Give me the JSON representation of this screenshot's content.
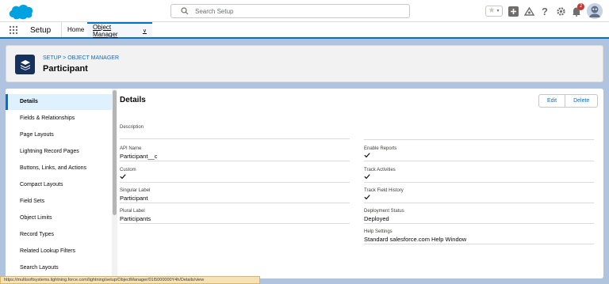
{
  "header": {
    "search_placeholder": "Search Setup",
    "notification_count": "2"
  },
  "context": {
    "app_name": "Setup",
    "tabs": [
      {
        "label": "Home"
      },
      {
        "label": "Object Manager"
      }
    ]
  },
  "page_header": {
    "breadcrumb": "SETUP > OBJECT MANAGER",
    "title": "Participant"
  },
  "sidebar": {
    "items": [
      {
        "label": "Details",
        "active": true
      },
      {
        "label": "Fields & Relationships"
      },
      {
        "label": "Page Layouts"
      },
      {
        "label": "Lightning Record Pages"
      },
      {
        "label": "Buttons, Links, and Actions"
      },
      {
        "label": "Compact Layouts"
      },
      {
        "label": "Field Sets"
      },
      {
        "label": "Object Limits"
      },
      {
        "label": "Record Types"
      },
      {
        "label": "Related Lookup Filters"
      },
      {
        "label": "Search Layouts"
      }
    ]
  },
  "details": {
    "title": "Details",
    "edit_label": "Edit",
    "delete_label": "Delete",
    "left_fields": [
      {
        "label": "Description",
        "value": ""
      },
      {
        "label": "API Name",
        "value": "Participant__c"
      },
      {
        "label": "Custom",
        "value": "",
        "checked": true
      },
      {
        "label": "Singular Label",
        "value": "Participant"
      },
      {
        "label": "Plural Label",
        "value": "Participants"
      }
    ],
    "right_fields": [
      {
        "label": "Enable Reports",
        "value": "",
        "checked": true
      },
      {
        "label": "Track Activities",
        "value": "",
        "checked": true
      },
      {
        "label": "Track Field History",
        "value": "",
        "checked": true
      },
      {
        "label": "Deployment Status",
        "value": "Deployed"
      },
      {
        "label": "Help Settings",
        "value": "Standard salesforce.com Help Window"
      }
    ]
  },
  "status_url": "https://multisoftsystems.lightning.force.com/lightning/setup/ObjectManager/01I5000000Y4h/Details/view",
  "colors": {
    "brand": "#0070d2",
    "background": "#b0c4df",
    "object_icon": "#16325c"
  }
}
